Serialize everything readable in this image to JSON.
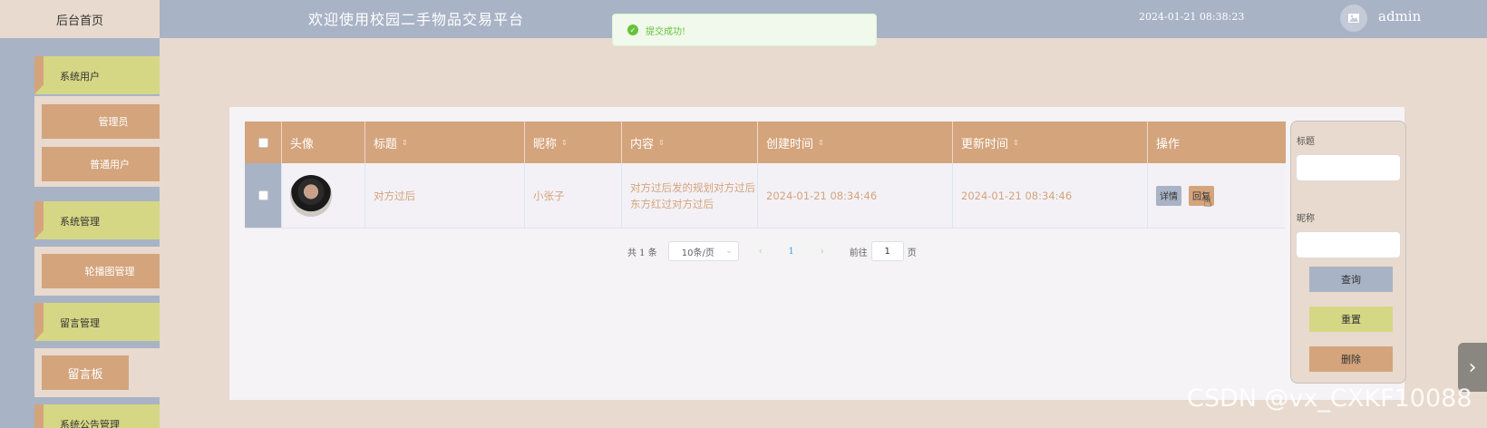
{
  "header": {
    "home_tab": "后台首页",
    "title": "欢迎使用校园二手物品交易平台",
    "datetime": "2024-01-21 08:38:23",
    "username": "admin"
  },
  "toast": {
    "message": "提交成功!"
  },
  "sidebar": {
    "groups": [
      {
        "label": "系统用户",
        "items": [
          "管理员",
          "普通用户"
        ]
      },
      {
        "label": "系统管理",
        "items": [
          "轮播图管理"
        ]
      },
      {
        "label": "留言管理",
        "items": [
          "留言板"
        ]
      },
      {
        "label": "系统公告管理",
        "items": []
      }
    ]
  },
  "table": {
    "columns": [
      "头像",
      "标题",
      "昵称",
      "内容",
      "创建时间",
      "更新时间",
      "操作"
    ],
    "sort_icon": "⇕",
    "rows": [
      {
        "title": "对方过后",
        "nickname": "小张子",
        "content": "对方过后发的规划对方过后东方红过对方过后",
        "created": "2024-01-21 08:34:46",
        "updated": "2024-01-21 08:34:46",
        "actions": {
          "detail": "详情",
          "reply": "回复"
        }
      }
    ]
  },
  "pagination": {
    "total": "共 1 条",
    "page_size": "10条/页",
    "current_page": "1",
    "goto_prefix": "前往",
    "goto_value": "1",
    "goto_suffix": "页"
  },
  "search": {
    "title_label": "标题",
    "nickname_label": "昵称",
    "query": "查询",
    "reset": "重置",
    "delete": "删除"
  },
  "watermark": "CSDN @vx_CXKF10088",
  "colors": {
    "header": "#a9b3c6",
    "page_bg": "#e8dace",
    "accent_brown": "#d4a47c",
    "accent_olive": "#d6d785"
  }
}
